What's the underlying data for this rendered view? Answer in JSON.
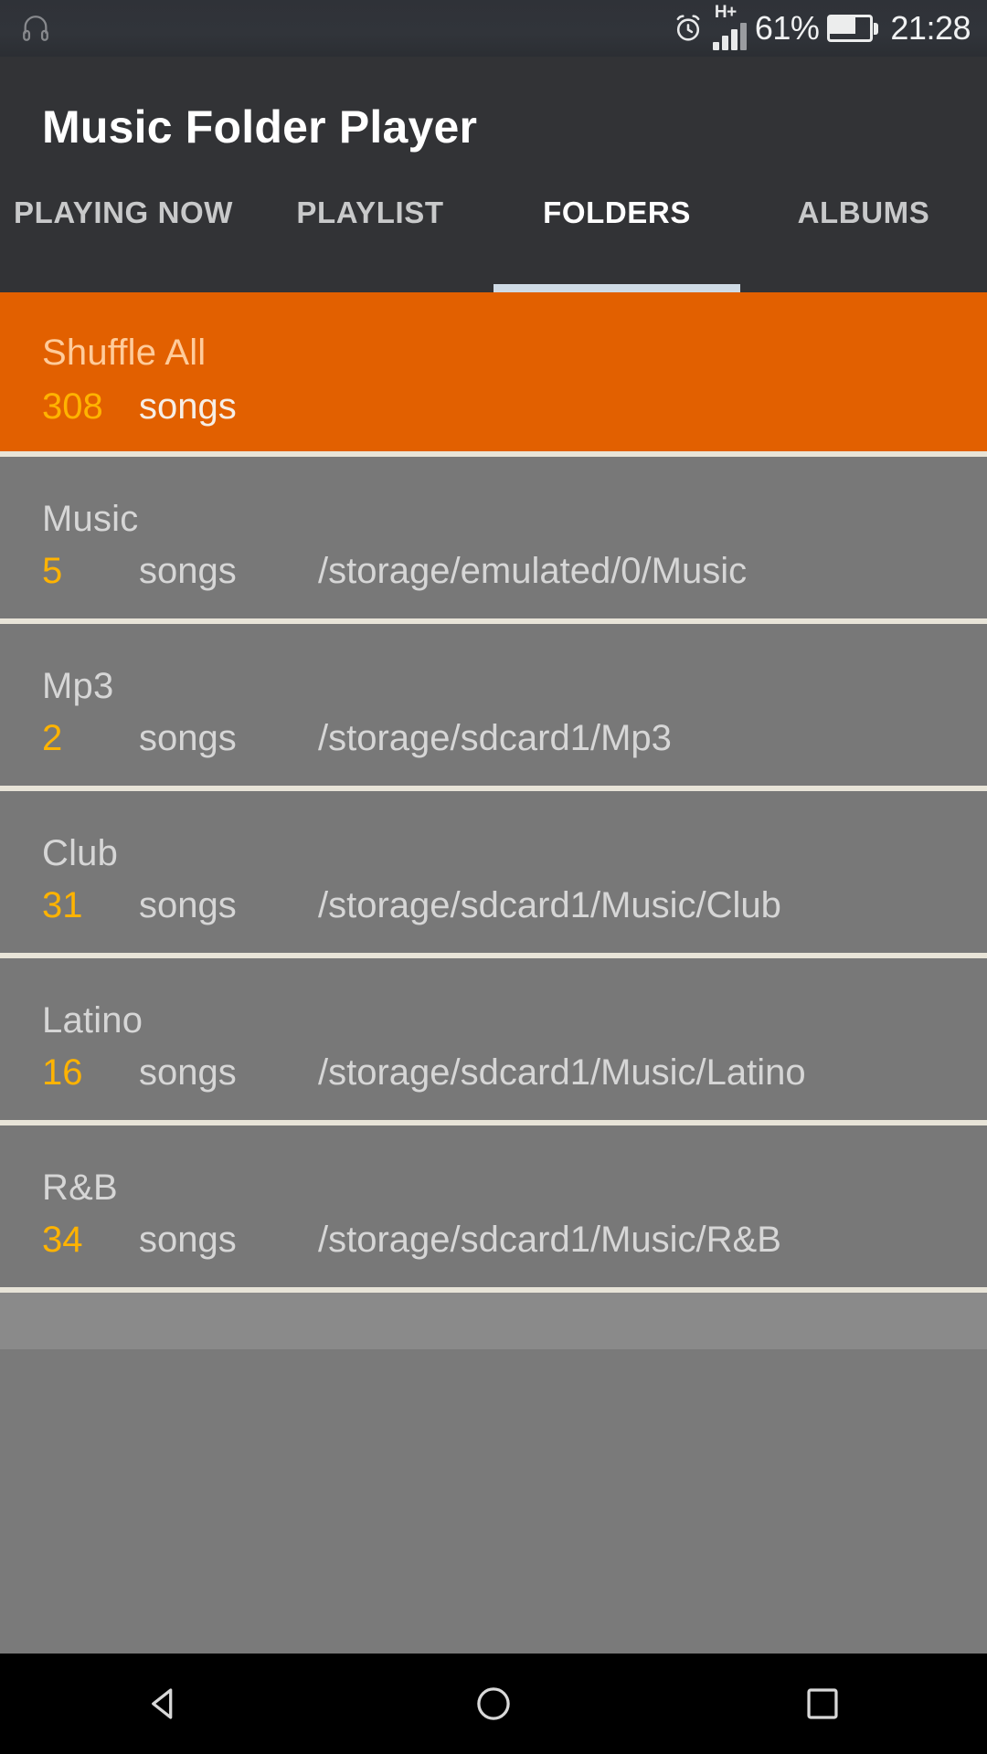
{
  "statusbar": {
    "headphone_icon": "headphone-icon",
    "alarm_icon": "alarm-clock-icon",
    "network_type": "H+",
    "signal_icon": "signal-bars-icon",
    "battery_percent": "61%",
    "battery_icon": "battery-icon",
    "time": "21:28"
  },
  "appbar": {
    "title": "Music Folder Player",
    "tabs": [
      {
        "label": "PLAYING NOW",
        "active": false
      },
      {
        "label": "PLAYLIST",
        "active": false
      },
      {
        "label": "FOLDERS",
        "active": true
      },
      {
        "label": "ALBUMS",
        "active": false
      }
    ]
  },
  "shuffle": {
    "title": "Shuffle All",
    "count": "308",
    "songs_label": "songs"
  },
  "folders": [
    {
      "name": "Music",
      "count": "5",
      "songs_label": "songs",
      "path": "/storage/emulated/0/Music"
    },
    {
      "name": "Mp3",
      "count": "2",
      "songs_label": "songs",
      "path": "/storage/sdcard1/Mp3"
    },
    {
      "name": "Club",
      "count": "31",
      "songs_label": "songs",
      "path": "/storage/sdcard1/Music/Club"
    },
    {
      "name": "Latino",
      "count": "16",
      "songs_label": "songs",
      "path": "/storage/sdcard1/Music/Latino"
    },
    {
      "name": "R&B",
      "count": "34",
      "songs_label": "songs",
      "path": "/storage/sdcard1/Music/R&B"
    }
  ],
  "navbar": {
    "back_icon": "back-triangle-icon",
    "home_icon": "home-circle-icon",
    "recents_icon": "recents-square-icon"
  },
  "colors": {
    "accent_orange": "#e26000",
    "count_amber": "#ffb300",
    "appbar_dark": "#323336",
    "list_gray": "#787878",
    "divider_cream": "#e8e4d8",
    "tab_indicator": "#cfdbe6"
  }
}
